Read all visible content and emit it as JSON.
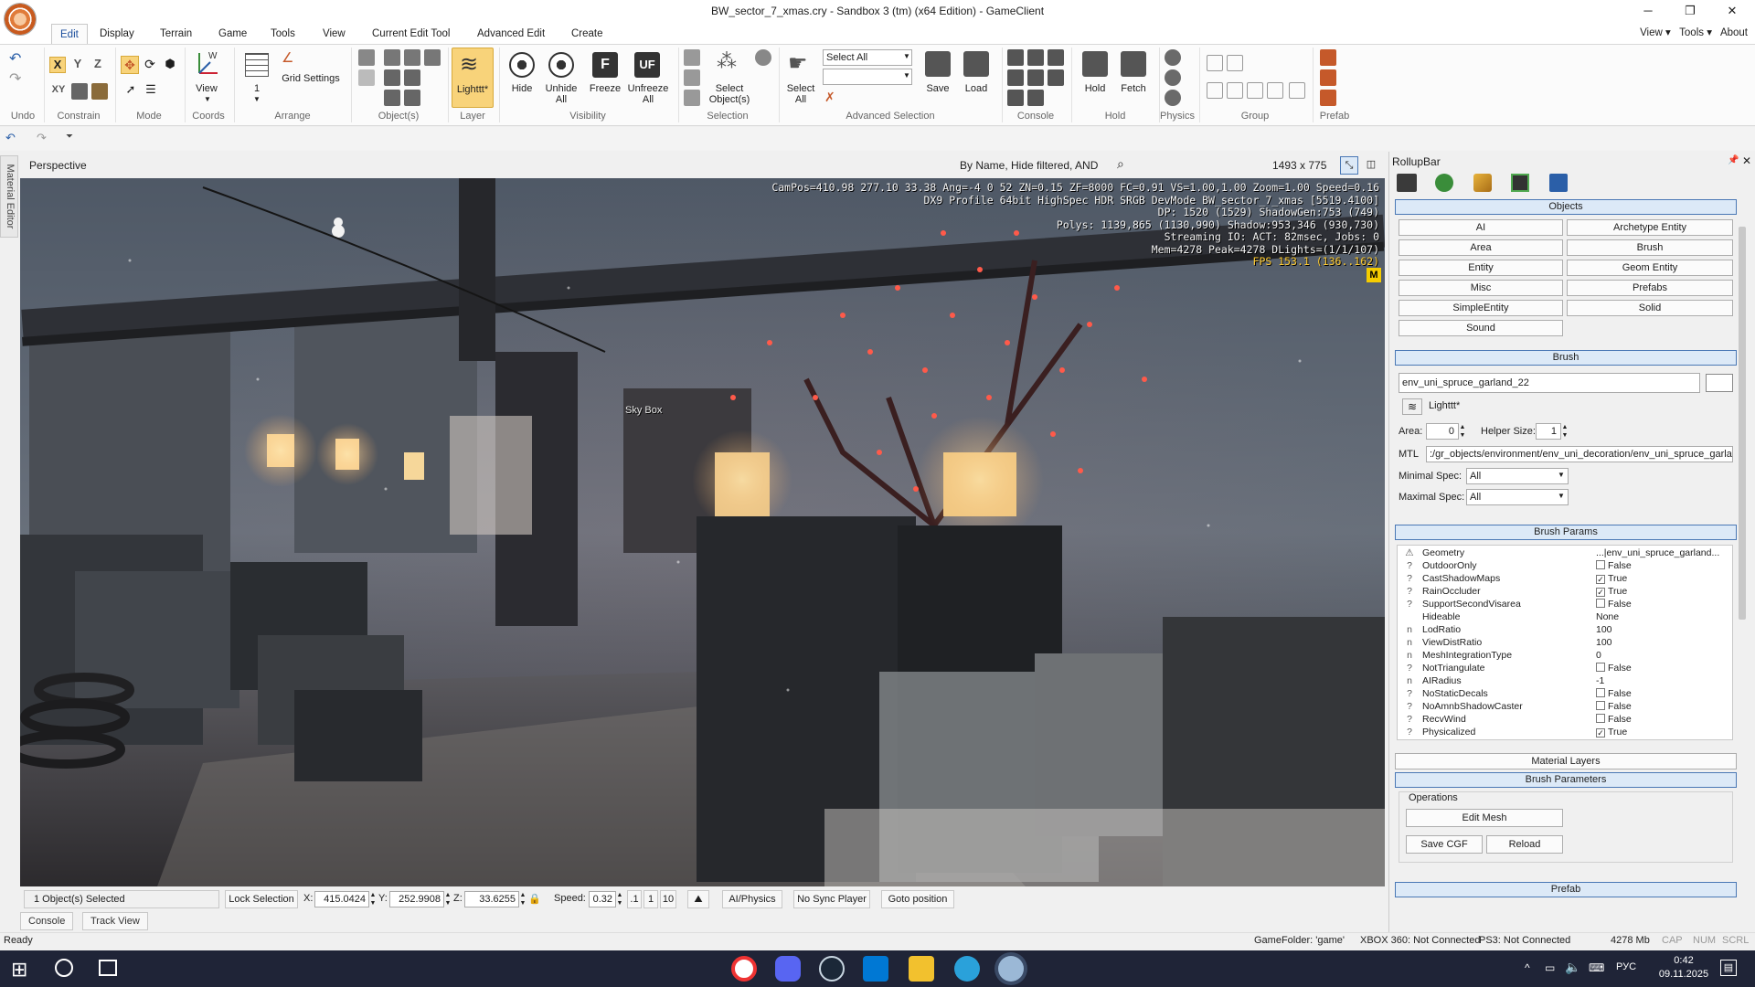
{
  "window": {
    "title": "BW_sector_7_xmas.cry - Sandbox 3 (tm) (x64 Edition) - GameClient",
    "minimize": "─",
    "maximize": "❐",
    "close": "✕"
  },
  "menu": {
    "tabs": [
      "Edit",
      "Display",
      "Terrain",
      "Game",
      "Tools",
      "View",
      "Current Edit Tool",
      "Advanced Edit",
      "Create"
    ],
    "active": "Edit",
    "right": [
      "View ▾",
      "Tools ▾",
      "About"
    ]
  },
  "ribbon": {
    "groups": [
      "Undo",
      "Constrain",
      "Mode",
      "Coords",
      "Arrange",
      "Object(s)",
      "Layer",
      "Visibility",
      "Selection",
      "Advanced Selection",
      "Console",
      "Hold",
      "Physics",
      "Group",
      "Prefab"
    ],
    "constrain": {
      "x": "X",
      "y": "Y",
      "z": "Z",
      "xy": "XY"
    },
    "view_label": "View",
    "arrange_num": "1",
    "grid_settings": "Grid Settings",
    "layer_label": "Lighttt*",
    "visibility": [
      "Hide",
      "Unhide All",
      "Freeze",
      "Unfreeze All"
    ],
    "freeze_glyph": "F",
    "unfreeze_glyph": "UF",
    "select_objects": "Select Object(s)",
    "select_all_btn": "Select All",
    "select_all_combo": "Select All",
    "save": "Save",
    "load": "Load",
    "hold": "Hold",
    "fetch": "Fetch"
  },
  "viewport": {
    "title": "Perspective",
    "filter": "By Name, Hide filtered, AND",
    "resolution": "1493 x 775",
    "skybox_label": "Sky Box",
    "marker": "M",
    "hud": [
      "CamPos=410.98 277.10 33.38 Ang=-4  0  52 ZN=0.15 ZF=8000 FC=0.91 VS=1.00,1.00 Zoom=1.00 Speed=0.16",
      "DX9 Profile 64bit HighSpec HDR SRGB DevMode BW_sector_7_xmas [5519.4100]",
      "DP: 1520 (1529) ShadowGen:753 (749)",
      "Polys: 1139,865 (1130,990) Shadow:953,346 (930,730)",
      "Streaming IO: ACT:  82msec, Jobs:  0",
      "Mem=4278 Peak=4278 DLights=(1/1/107)"
    ],
    "fps": "FPS 153.1 (136..162)"
  },
  "material_editor": "Material Editor",
  "statusrow": {
    "selected": "1 Object(s) Selected",
    "lock": "Lock Selection",
    "x_label": "X:",
    "x": "415.0424",
    "y_label": "Y:",
    "y": "252.9908",
    "z_label": "Z:",
    "z": "33.6255",
    "speed_label": "Speed:",
    "speed": "0.32",
    "s1": ".1",
    "s2": "1",
    "s3": "10",
    "ai": "AI/Physics",
    "nosync": "No Sync Player",
    "goto": "Goto position"
  },
  "bottom_tabs": [
    "Console",
    "Track View"
  ],
  "statusbar": {
    "ready": "Ready",
    "gamefolder": "GameFolder: 'game'",
    "xbox": "XBOX 360: Not Connected",
    "ps3": "PS3: Not Connected",
    "mem": "4278 Mb",
    "cap": "CAP",
    "num": "NUM",
    "scrl": "SCRL"
  },
  "rollup": {
    "title": "RollupBar",
    "pin": "📌",
    "close": "✕",
    "objects_header": "Objects",
    "object_buttons": [
      "AI",
      "Archetype Entity",
      "Area",
      "Brush",
      "Entity",
      "Geom Entity",
      "Misc",
      "Prefabs",
      "SimpleEntity",
      "Solid",
      "Sound"
    ],
    "brush_header": "Brush",
    "brush_name": "env_uni_spruce_garland_22",
    "layer": "Lighttt*",
    "area_label": "Area:",
    "area": "0",
    "helper_label": "Helper Size:",
    "helper": "1",
    "mtl_label": "MTL",
    "mtl": ":/gr_objects/environment/env_uni_decoration/env_uni_spruce_garla",
    "minspec_label": "Minimal Spec:",
    "minspec": "All",
    "maxspec_label": "Maximal Spec:",
    "maxspec": "All",
    "params_header": "Brush Params",
    "params": [
      {
        "icon": "⚠",
        "name": "Geometry",
        "value": "...|env_uni_spruce_garland...",
        "chk": ""
      },
      {
        "icon": "?",
        "name": "OutdoorOnly",
        "value": "False",
        "chk": "off"
      },
      {
        "icon": "?",
        "name": "CastShadowMaps",
        "value": "True",
        "chk": "on"
      },
      {
        "icon": "?",
        "name": "RainOccluder",
        "value": "True",
        "chk": "on"
      },
      {
        "icon": "?",
        "name": "SupportSecondVisarea",
        "value": "False",
        "chk": "off"
      },
      {
        "icon": "",
        "name": "Hideable",
        "value": "None",
        "chk": ""
      },
      {
        "icon": "n",
        "name": "LodRatio",
        "value": "100",
        "chk": ""
      },
      {
        "icon": "n",
        "name": "ViewDistRatio",
        "value": "100",
        "chk": ""
      },
      {
        "icon": "n",
        "name": "MeshIntegrationType",
        "value": "0",
        "chk": ""
      },
      {
        "icon": "?",
        "name": "NotTriangulate",
        "value": "False",
        "chk": "off"
      },
      {
        "icon": "n",
        "name": "AIRadius",
        "value": "-1",
        "chk": ""
      },
      {
        "icon": "?",
        "name": "NoStaticDecals",
        "value": "False",
        "chk": "off"
      },
      {
        "icon": "?",
        "name": "NoAmnbShadowCaster",
        "value": "False",
        "chk": "off"
      },
      {
        "icon": "?",
        "name": "RecvWind",
        "value": "False",
        "chk": "off"
      },
      {
        "icon": "?",
        "name": "Physicalized",
        "value": "True",
        "chk": "on"
      }
    ],
    "material_layers": "Material Layers",
    "brush_parameters": "Brush Parameters",
    "operations": "Operations",
    "edit_mesh": "Edit Mesh",
    "save_cgf": "Save CGF",
    "reload": "Reload",
    "prefab_header": "Prefab"
  },
  "taskbar": {
    "time": "0:42",
    "date": "09.11.2025",
    "lang": "РУС",
    "start": "⊞"
  },
  "colors": {
    "accent": "#4a78b5",
    "layer_active": "#f8d37a",
    "hud_fps": "#ffcc33",
    "taskbar": "#1f2437"
  }
}
